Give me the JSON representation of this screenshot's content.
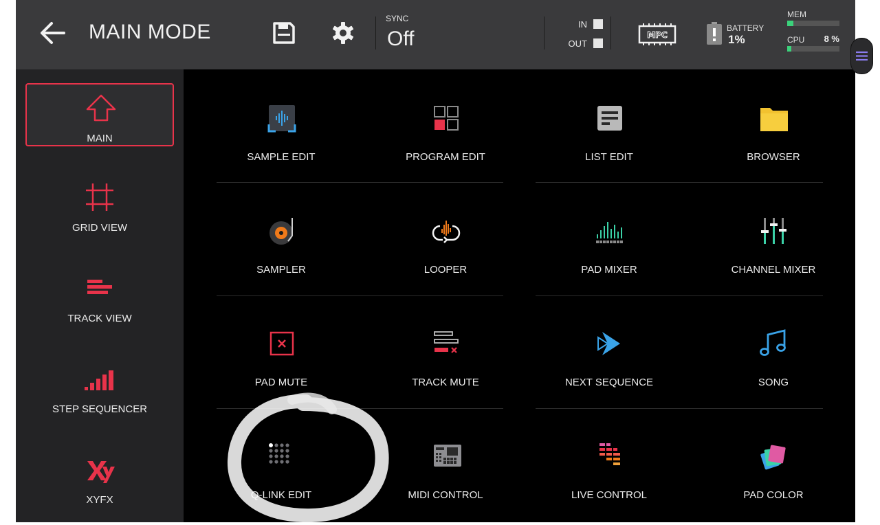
{
  "header": {
    "title": "MAIN MODE",
    "sync_label": "SYNC",
    "sync_value": "Off",
    "in_label": "IN",
    "out_label": "OUT",
    "mpc_badge": "MPC",
    "battery_label": "BATTERY",
    "battery_value": "1%",
    "mem_label": "MEM",
    "mem_level": 0.12,
    "cpu_label": "CPU",
    "cpu_value": "8 %",
    "cpu_level": 0.08
  },
  "sidebar": {
    "items": [
      {
        "label": "MAIN",
        "icon": "home-arrow-icon"
      },
      {
        "label": "GRID VIEW",
        "icon": "grid-icon"
      },
      {
        "label": "TRACK VIEW",
        "icon": "track-bars-icon"
      },
      {
        "label": "STEP SEQUENCER",
        "icon": "step-bars-icon"
      },
      {
        "label": "XYFX",
        "icon": "xy-icon"
      }
    ],
    "active_index": 0
  },
  "grid": {
    "tiles": [
      {
        "label": "SAMPLE EDIT",
        "icon": "waveform-icon"
      },
      {
        "label": "PROGRAM EDIT",
        "icon": "program-grid-icon"
      },
      {
        "label": "LIST EDIT",
        "icon": "list-icon"
      },
      {
        "label": "BROWSER",
        "icon": "folder-icon"
      },
      {
        "label": "SAMPLER",
        "icon": "turntable-icon"
      },
      {
        "label": "LOOPER",
        "icon": "loop-icon"
      },
      {
        "label": "PAD MIXER",
        "icon": "pad-mixer-icon"
      },
      {
        "label": "CHANNEL MIXER",
        "icon": "faders-icon"
      },
      {
        "label": "PAD MUTE",
        "icon": "pad-mute-icon"
      },
      {
        "label": "TRACK MUTE",
        "icon": "track-mute-icon"
      },
      {
        "label": "NEXT SEQUENCE",
        "icon": "next-sequence-icon"
      },
      {
        "label": "SONG",
        "icon": "music-note-icon"
      },
      {
        "label": "Q-LINK EDIT",
        "icon": "qlink-dots-icon"
      },
      {
        "label": "MIDI CONTROL",
        "icon": "midi-controller-icon"
      },
      {
        "label": "LIVE CONTROL",
        "icon": "live-control-icon"
      },
      {
        "label": "PAD COLOR",
        "icon": "color-swatch-icon"
      }
    ]
  },
  "colors": {
    "accent_red": "#e8334a",
    "green": "#3bd27b",
    "blue": "#3aa3e8",
    "yellow": "#f2c230",
    "orange": "#f07a1a",
    "header_bg": "#3a3a3c",
    "sidebar_bg": "#232325"
  }
}
